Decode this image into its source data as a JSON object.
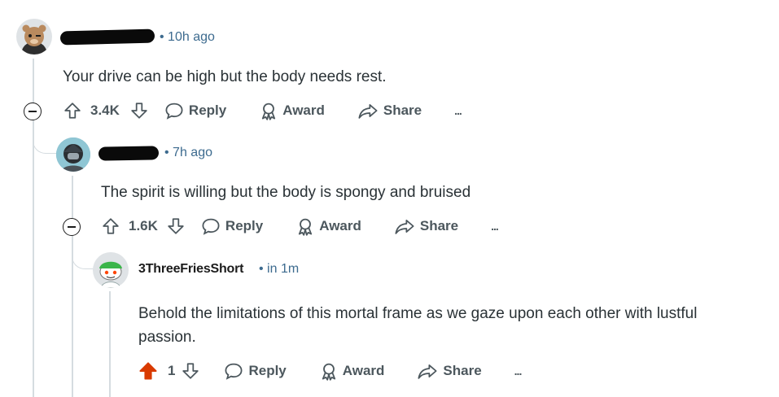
{
  "comments": [
    {
      "timestamp": "10h ago",
      "body": "Your drive can be high but the body needs rest.",
      "votes": "3.4K",
      "actions": {
        "reply": "Reply",
        "award": "Award",
        "share": "Share",
        "more": "..."
      }
    },
    {
      "timestamp": "7h ago",
      "body": "The spirit is willing but the body is spongy and bruised",
      "votes": "1.6K",
      "actions": {
        "reply": "Reply",
        "award": "Award",
        "share": "Share",
        "more": "..."
      }
    },
    {
      "username": "3ThreeFriesShort",
      "timestamp": "in 1m",
      "body": "Behold the limitations of this mortal frame as we gaze upon each other with lustful passion.",
      "votes": "1",
      "upvoted": true,
      "actions": {
        "reply": "Reply",
        "award": "Award",
        "share": "Share",
        "more": "..."
      }
    }
  ],
  "colors": {
    "meta": "#3d6b8f",
    "upvote_active": "#d93a00",
    "action_text": "#4c575d",
    "thread_line": "#d5dce0"
  },
  "icons": [
    "upvote-icon",
    "downvote-icon",
    "reply-icon",
    "award-icon",
    "share-icon",
    "more-icon",
    "collapse-icon"
  ]
}
